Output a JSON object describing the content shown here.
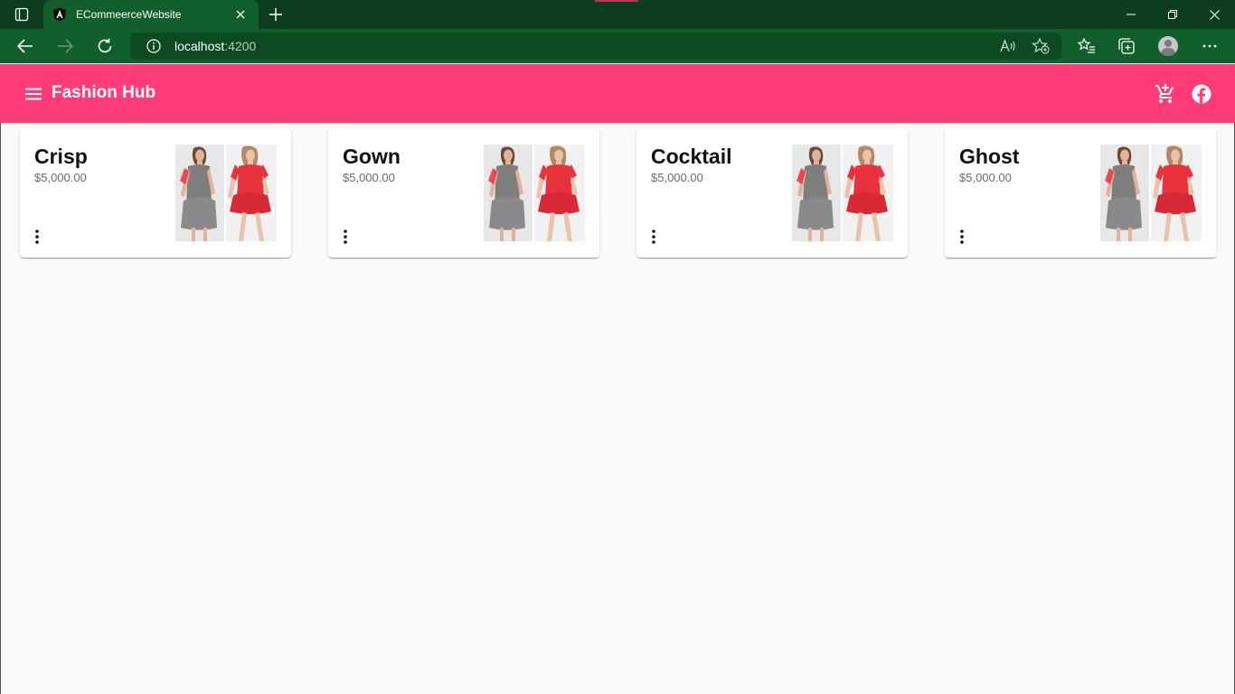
{
  "browser": {
    "tab_title": "ECommeerceWebsite",
    "address_host": "localhost",
    "address_port": ":4200"
  },
  "app": {
    "brand": "Fashion Hub"
  },
  "products": [
    {
      "name": "Crisp",
      "price": "$5,000.00"
    },
    {
      "name": "Gown",
      "price": "$5,000.00"
    },
    {
      "name": "Cocktail",
      "price": "$5,000.00"
    },
    {
      "name": "Ghost",
      "price": "$5,000.00"
    }
  ],
  "colors": {
    "toolbar": "#ff3b78",
    "browser_frame": "#125f2e",
    "dress_red": "#e8333f",
    "dress_gray": "#7e7e7e"
  },
  "icons": {
    "menu": "menu-icon",
    "cart": "add-shopping-cart-icon",
    "facebook": "facebook-icon",
    "more": "more-vert-icon"
  }
}
